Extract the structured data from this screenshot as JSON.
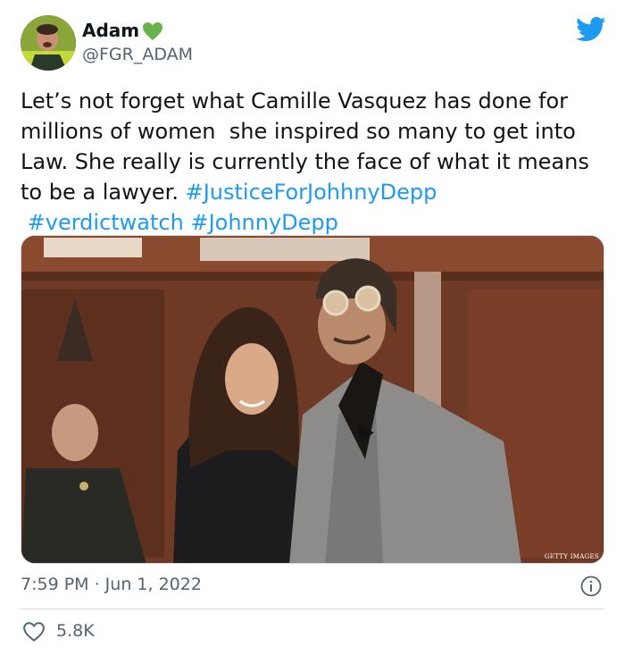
{
  "author": {
    "display_name": "Adam",
    "handle": "@FGR_ADAM",
    "verified_icon": "green-heart-icon"
  },
  "tweet": {
    "text_plain": "Let’s not forget what Camille Vasquez has done for millions of women  she inspired so many to get into Law. She really is currently the face of what it means to be a lawyer. ",
    "hashtag_1": "#JusticeForJohhnyDepp",
    "hashtag_2": "#verdictwatch",
    "hashtag_3": "#JohnnyDepp"
  },
  "media": {
    "watermark": "GETTY IMAGES"
  },
  "meta": {
    "timestamp": "7:59 PM · Jun 1, 2022"
  },
  "engagement": {
    "likes": "5.8K"
  },
  "colors": {
    "link": "#1d9bf0",
    "secondary_text": "#536471",
    "heart": "#6bb24d",
    "twitter_blue": "#1d9bf0"
  }
}
